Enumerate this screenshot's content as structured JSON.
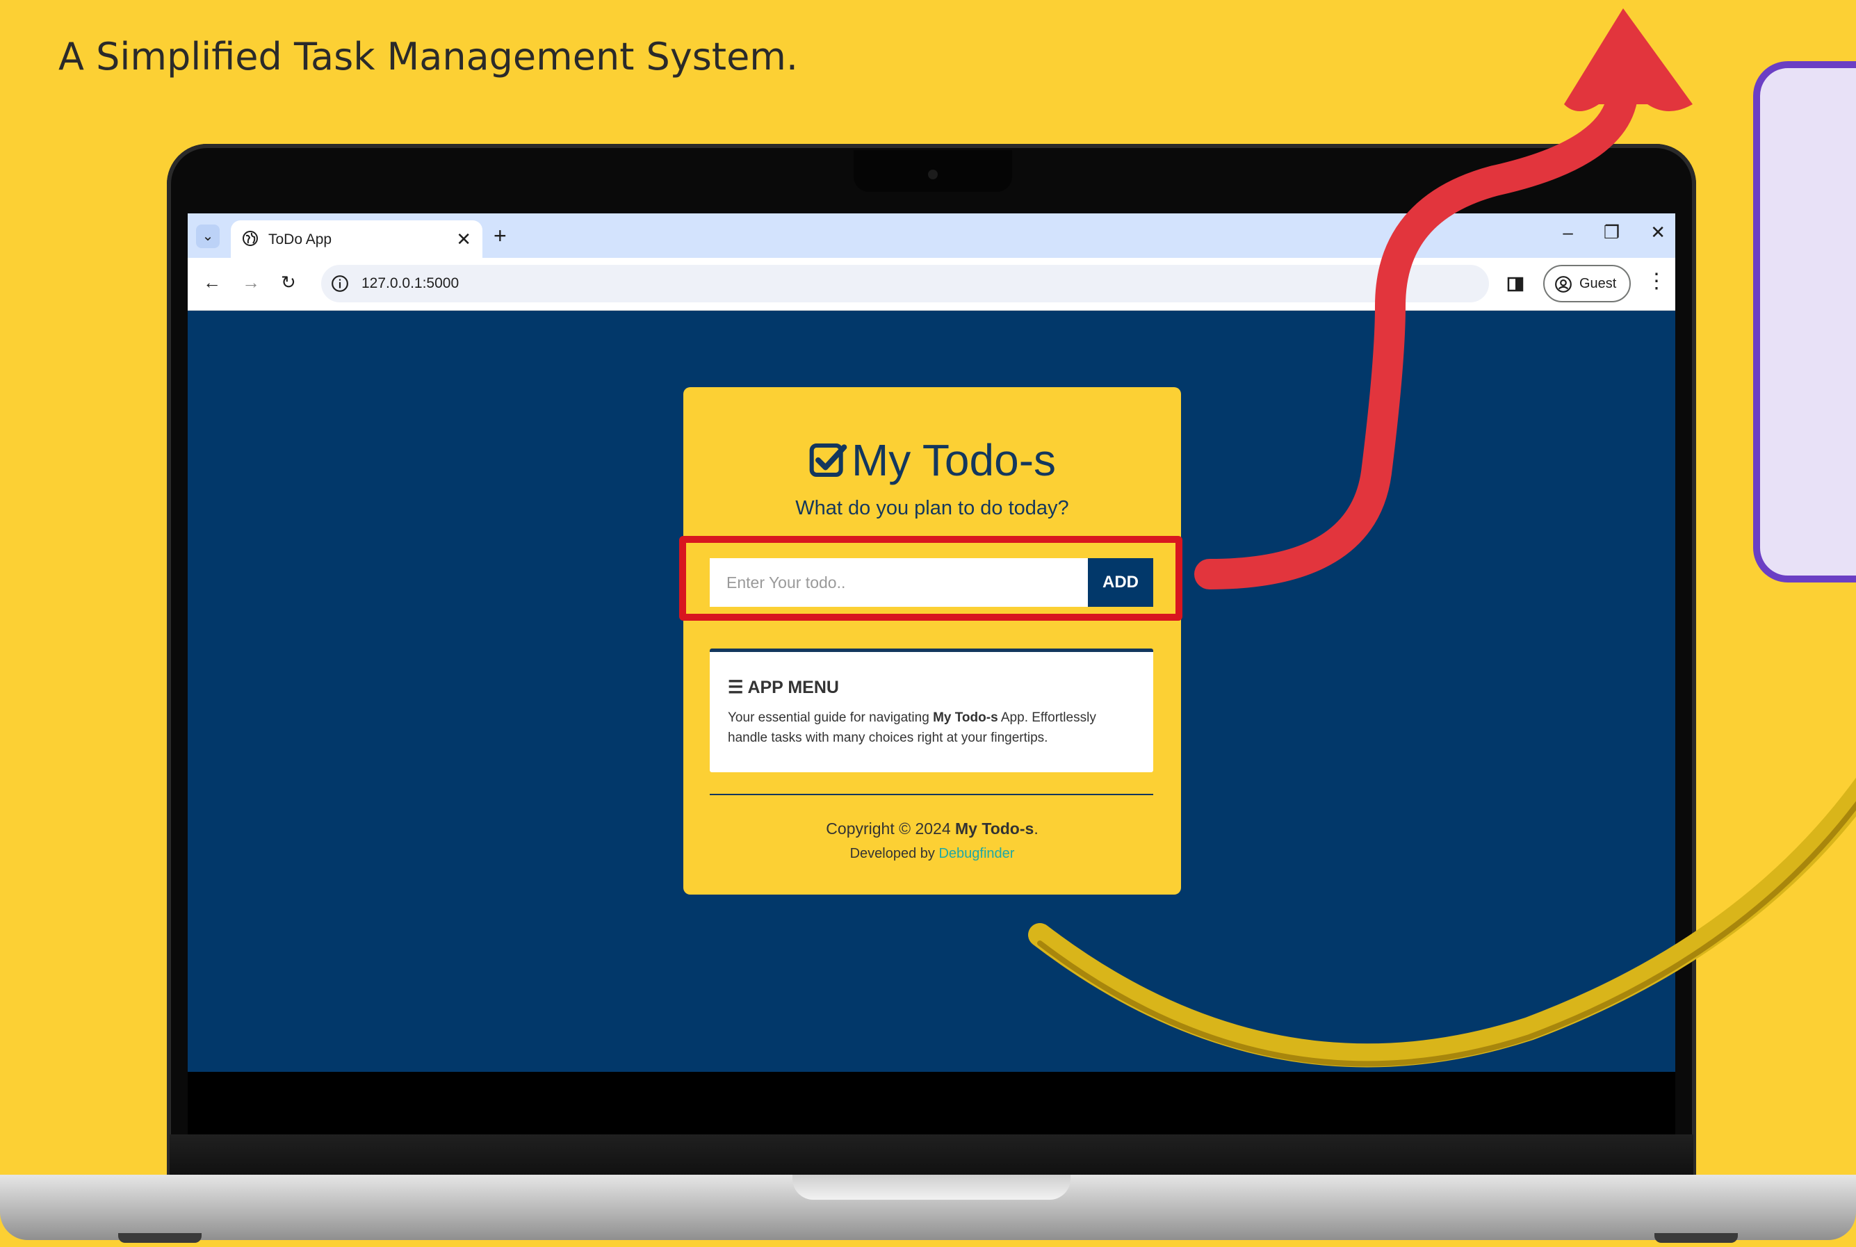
{
  "promo": {
    "subtitle": "A Simplified Task Management System."
  },
  "browser": {
    "tab_title": "ToDo App",
    "new_tab_label": "+",
    "url": "127.0.0.1:5000",
    "guest_label": "Guest"
  },
  "app": {
    "title": "My Todo-s",
    "subtitle": "What do you plan to do today?",
    "input_placeholder": "Enter Your todo..",
    "add_label": "ADD",
    "menu": {
      "heading": "APP MENU",
      "text_before": "Your essential guide for navigating ",
      "text_bold": "My Todo-s",
      "text_after": " App. Effortlessly handle tasks with many choices right at your fingertips."
    },
    "footer": {
      "copyright_prefix": "Copyright © 2024 ",
      "copyright_brand": "My Todo-s",
      "copyright_suffix": ".",
      "developed_prefix": "Developed by ",
      "developer": "Debugfinder"
    }
  },
  "colors": {
    "background": "#fcd034",
    "app_bg": "#02386a",
    "accent_purple": "#6b3fc4",
    "highlight_red": "#d8161f",
    "link_teal": "#1fa9a4"
  },
  "icons": [
    "globe-icon",
    "info-icon",
    "check-square-icon",
    "hamburger-icon",
    "profile-icon",
    "side-panel-icon"
  ]
}
